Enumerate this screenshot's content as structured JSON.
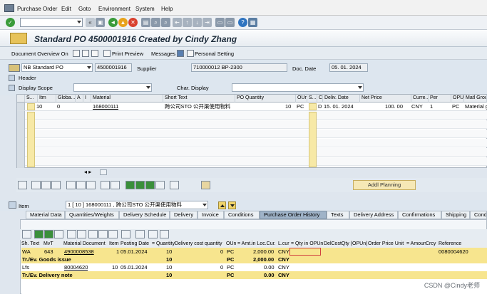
{
  "menu": {
    "items": [
      "Purchase Order",
      "Edit",
      "Goto",
      "Environment",
      "System",
      "Help"
    ]
  },
  "title": "Standard PO 4500001916 Created by Cindy Zhang",
  "app_toolbar": {
    "doc_overview": "Document Overview On",
    "print_preview": "Print Preview",
    "messages": "Messages",
    "personal_setting": "Personal Setting"
  },
  "header_form": {
    "po_type": "NB Standard PO",
    "po_number": "4500001916",
    "supplier_label": "Supplier",
    "supplier_value": "710000012 BP-2300",
    "doc_date_label": "Doc. Date",
    "doc_date_value": "05. 01. 2024",
    "header_label": "Header",
    "display_scope_label": "Display Scope",
    "char_display_label": "Char. Display"
  },
  "items_table": {
    "headers": [
      "S...",
      "Itm",
      "Globa...",
      "A",
      "I",
      "Material",
      "Short Text",
      "PO Quantity",
      "OUn",
      "S...",
      "C",
      "Deliv. Date",
      "Net Price",
      "Curre...",
      "Per",
      "OPU",
      "Matl Grou"
    ],
    "rows": [
      [
        "",
        "10",
        "0",
        "",
        "",
        "168000111",
        "跨公司STO 公开渠使用物料",
        "10",
        "PC",
        "",
        "D",
        "15. 01. 2024",
        "100. 00",
        "CNY",
        "1",
        "PC",
        "Material g"
      ]
    ]
  },
  "addl_planning": "Addl Planning",
  "item_line": {
    "label": "Item",
    "value": "1 [ 10 ] 168000111 , 跨公司STO 公开渠使用物料"
  },
  "tabs": [
    "Material Data",
    "Quantities/Weights",
    "Delivery Schedule",
    "Delivery",
    "Invoice",
    "Conditions",
    "Purchase Order History",
    "Texts",
    "Delivery Address",
    "Confirmations",
    "Shipping",
    "Cond"
  ],
  "history": {
    "headers": [
      "Sh. Text",
      "MvT",
      "Material Document",
      "Item",
      "Posting Date",
      "= Quantity",
      "Delivery cost quantity",
      "OUn",
      "= Amt.in Loc.Cur.",
      "L.cur",
      "= Qty in OPUn",
      "DelCostQty (OPUn)",
      "Order Price Unit",
      "= Amount",
      "Crcy",
      "Reference"
    ],
    "rows": [
      {
        "text": "WA",
        "mvt": "643",
        "doc": "4900008538",
        "item": "1",
        "date": "05.01.2024",
        "qty": "10",
        "dcq": "0",
        "oun": "PC",
        "amt": "2,000.00",
        "lcur": "CNY",
        "ref": "0080004620"
      },
      {
        "text": "Tr./Ev. Goods issue",
        "mvt": "",
        "doc": "",
        "item": "",
        "date": "",
        "qty": "10",
        "dcq": "",
        "oun": "PC",
        "amt": "2,000.00",
        "lcur": "CNY",
        "ref": ""
      },
      {
        "text": "Lfs",
        "mvt": "",
        "doc": "80004620",
        "item": "10",
        "date": "05.01.2024",
        "qty": "10",
        "dcq": "0",
        "oun": "PC",
        "amt": "0.00",
        "lcur": "CNY",
        "ref": ""
      },
      {
        "text": "Tr./Ev. Delivery note",
        "mvt": "",
        "doc": "",
        "item": "",
        "date": "",
        "qty": "10",
        "dcq": "",
        "oun": "PC",
        "amt": "0.00",
        "lcur": "CNY",
        "ref": ""
      }
    ]
  },
  "watermark": "CSDN @Cindy老师"
}
